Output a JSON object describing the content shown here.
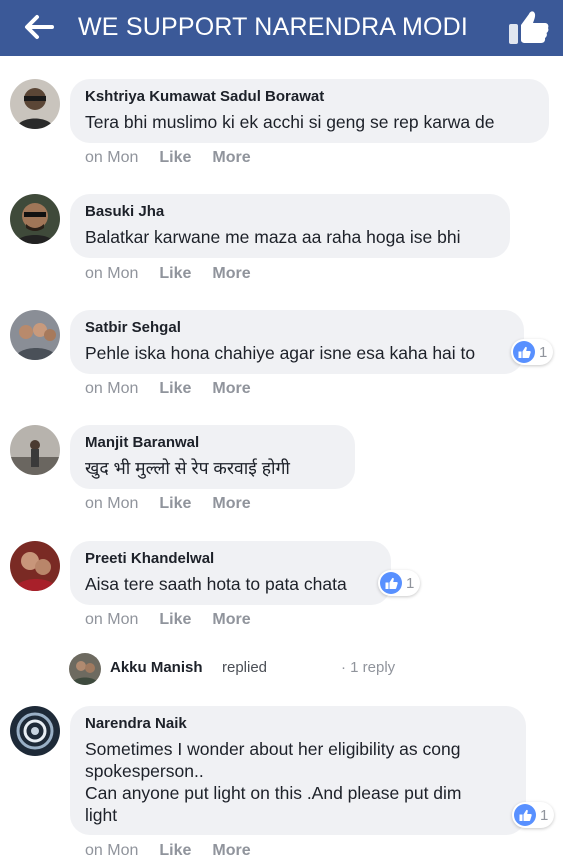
{
  "header": {
    "title": "WE SUPPORT NARENDRA MODI",
    "background": "#3b5998"
  },
  "comments": [
    {
      "name": "Kshtriya Kumawat Sadul Borawat",
      "text": "Tera bhi muslimo ki ek acchi si geng se rep karwa de",
      "time": "on Mon",
      "like": "Like",
      "more": "More"
    },
    {
      "name": "Basuki Jha",
      "text": "Balatkar karwane me maza aa raha hoga ise bhi",
      "time": "on Mon",
      "like": "Like",
      "more": "More"
    },
    {
      "name": "Satbir Sehgal",
      "text": "Pehle iska hona chahiye agar isne esa kaha hai to",
      "time": "on Mon",
      "like": "Like",
      "more": "More",
      "reactions": "1"
    },
    {
      "name": "Manjit Baranwal",
      "text": "खुद भी मुल्लो से रेप करवाई होगी",
      "time": "on Mon",
      "like": "Like",
      "more": "More"
    },
    {
      "name": "Preeti Khandelwal",
      "text": "Aisa tere saath hota to pata chata",
      "time": "on Mon",
      "like": "Like",
      "more": "More",
      "reactions": "1"
    },
    {
      "name": "Narendra Naik",
      "text_lines": [
        "Sometimes I wonder about her eligibility as cong",
        "spokesperson..",
        "Can anyone put light on this .And please put dim",
        "light"
      ],
      "time": "on Mon",
      "like": "Like",
      "more": "More",
      "reactions": "1"
    }
  ],
  "reply_summary": {
    "name": "Akku Manish",
    "verb": "replied",
    "count": "· 1 reply"
  },
  "colors": {
    "bubble": "#f0f1f4",
    "meta": "#90949c",
    "like_blue": "#5890ff"
  },
  "icons": [
    "back-arrow-icon",
    "thumbs-up-icon"
  ]
}
